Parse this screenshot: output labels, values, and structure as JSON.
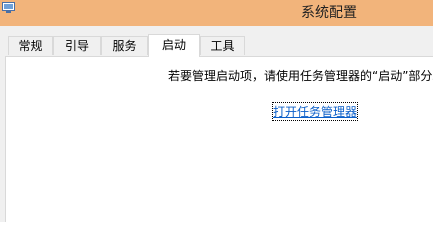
{
  "window": {
    "title": "系统配置",
    "app_icon": "system-config-icon",
    "titlebar_color": "#f2b47b"
  },
  "tabs": [
    {
      "label": "常规",
      "active": false
    },
    {
      "label": "引导",
      "active": false
    },
    {
      "label": "服务",
      "active": false
    },
    {
      "label": "启动",
      "active": true
    },
    {
      "label": "工具",
      "active": false
    }
  ],
  "startup": {
    "message": "若要管理启动项，请使用任务管理器的“启动”部分。",
    "link_label": "打开任务管理器",
    "link_color": "#0b5fc9"
  }
}
